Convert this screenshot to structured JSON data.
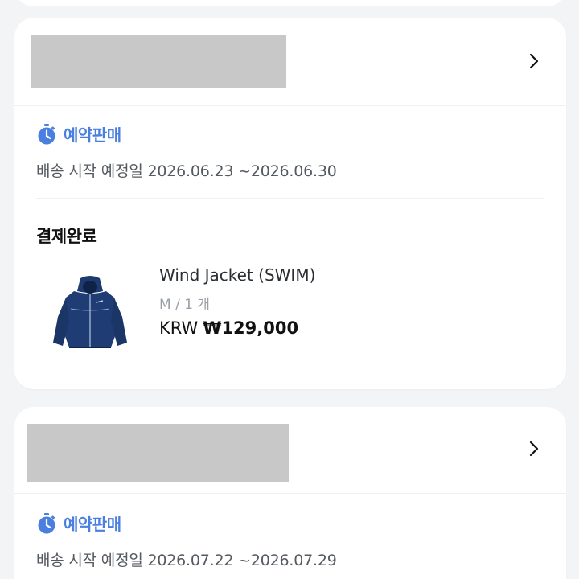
{
  "orders": [
    {
      "sale_type": "예약판매",
      "shipping_label": "배송 시작 예정일",
      "shipping_range": "2026.06.23 ~2026.06.30",
      "status": "결제완료",
      "product": {
        "name": "Wind Jacket (SWIM)",
        "option": "M / 1 개",
        "currency": "KRW",
        "price": "₩129,000",
        "image_icon": "navy-hooded-jacket"
      }
    },
    {
      "sale_type": "예약판매",
      "shipping_label": "배송 시작 예정일",
      "shipping_range": "2026.07.22 ~2026.07.29"
    }
  ],
  "colors": {
    "accent": "#4a7fe0",
    "background": "#f3f4f6",
    "card": "#ffffff",
    "redacted": "#c8c8c8",
    "jacket": "#1e3a6e"
  }
}
